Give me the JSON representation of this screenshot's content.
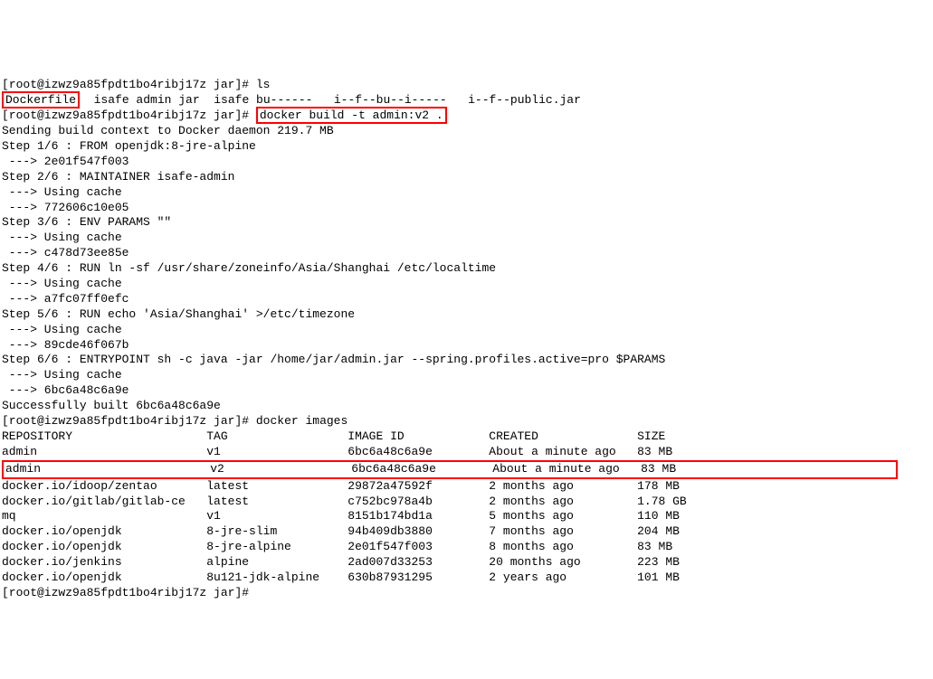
{
  "lines": {
    "l1_prefix": "[root@izwz9a85fpdt1bo4ribj17z jar]# ",
    "l1_cmd": "ls",
    "l2_file": "Dockerfile",
    "l2_rest": "  isafe admin jar  isafe bu------   i--f--bu--i-----   i--f--public.jar",
    "l3_prefix": "[root@izwz9a85fpdt1bo4ribj17z jar]# ",
    "l3_cmd": "docker build -t admin:v2 .",
    "l4": "Sending build context to Docker daemon 219.7 MB",
    "l5": "Step 1/6 : FROM openjdk:8-jre-alpine",
    "l6": " ---> 2e01f547f003",
    "l7": "Step 2/6 : MAINTAINER isafe-admin",
    "l8": " ---> Using cache",
    "l9": " ---> 772606c10e05",
    "l10": "Step 3/6 : ENV PARAMS \"\"",
    "l11": " ---> Using cache",
    "l12": " ---> c478d73ee85e",
    "l13": "Step 4/6 : RUN ln -sf /usr/share/zoneinfo/Asia/Shanghai /etc/localtime",
    "l14": " ---> Using cache",
    "l15": " ---> a7fc07ff0efc",
    "l16": "Step 5/6 : RUN echo 'Asia/Shanghai' >/etc/timezone",
    "l17": " ---> Using cache",
    "l18": " ---> 89cde46f067b",
    "l19": "Step 6/6 : ENTRYPOINT sh -c java -jar /home/jar/admin.jar --spring.profiles.active=pro $PARAMS",
    "l20": " ---> Using cache",
    "l21": " ---> 6bc6a48c6a9e",
    "l22": "Successfully built 6bc6a48c6a9e",
    "l23_prefix": "[root@izwz9a85fpdt1bo4ribj17z jar]# ",
    "l23_cmd": "docker images",
    "header": "REPOSITORY                   TAG                 IMAGE ID            CREATED              SIZE",
    "row1": "admin                        v1                  6bc6a48c6a9e        About a minute ago   83 MB",
    "row2": "admin                        v2                  6bc6a48c6a9e        About a minute ago   83 MB",
    "row3": "docker.io/idoop/zentao       latest              29872a47592f        2 months ago         178 MB",
    "row4": "docker.io/gitlab/gitlab-ce   latest              c752bc978a4b        2 months ago         1.78 GB",
    "row5": "mq                           v1                  8151b174bd1a        5 months ago         110 MB",
    "row6": "docker.io/openjdk            8-jre-slim          94b409db3880        7 months ago         204 MB",
    "row7": "docker.io/openjdk            8-jre-alpine        2e01f547f003        8 months ago         83 MB",
    "row8": "docker.io/jenkins            alpine              2ad007d33253        20 months ago        223 MB",
    "row9": "docker.io/openjdk            8u121-jdk-alpine    630b87931295        2 years ago          101 MB",
    "l_last": "[root@izwz9a85fpdt1bo4ribj17z jar]# "
  }
}
